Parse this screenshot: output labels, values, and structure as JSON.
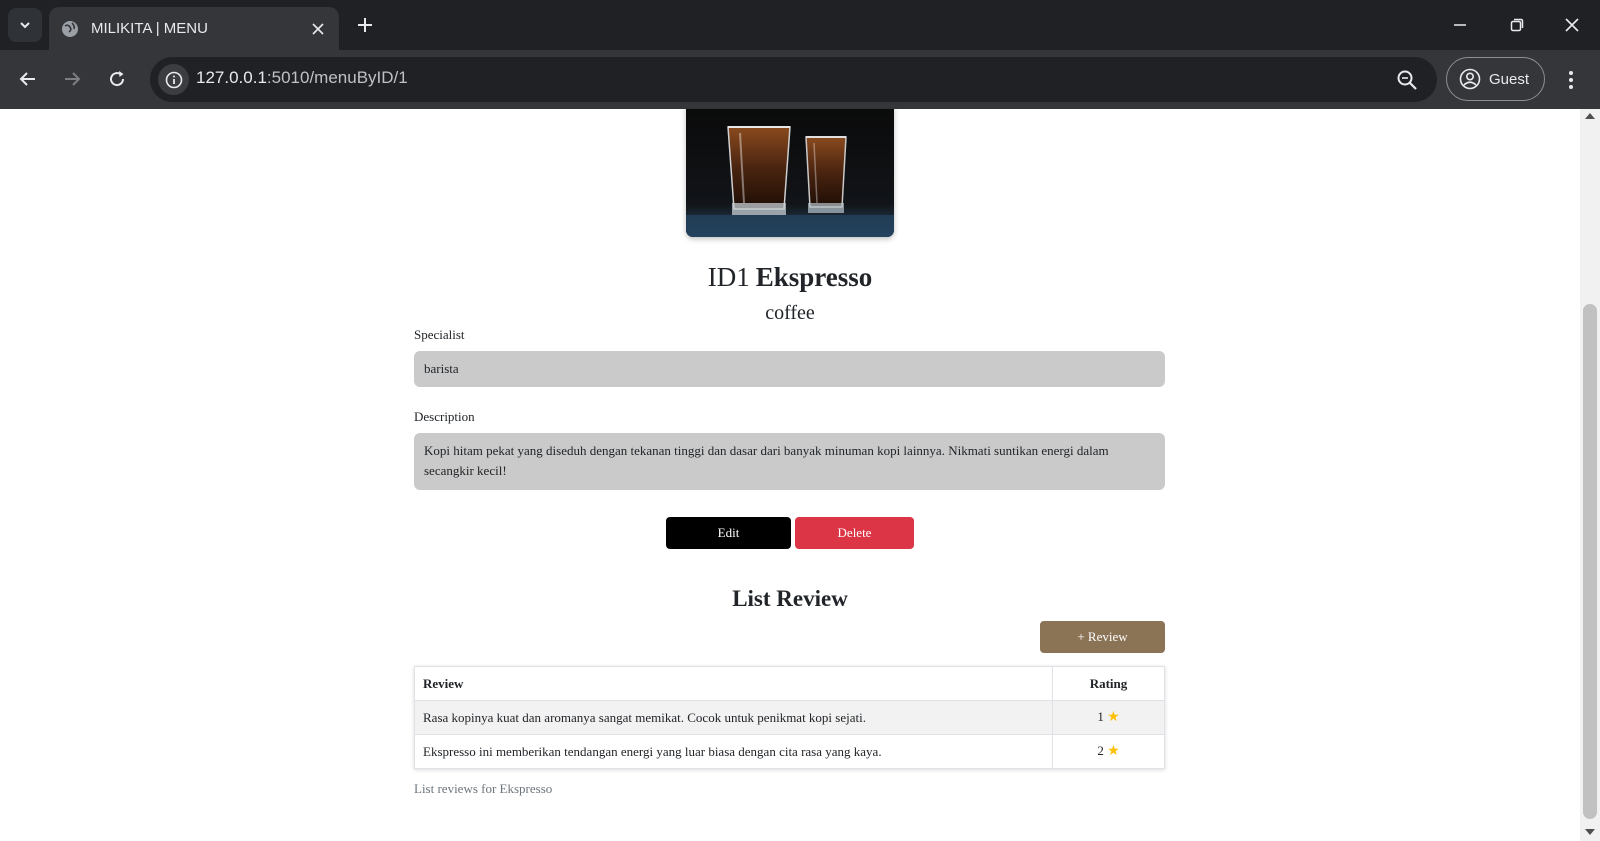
{
  "browser": {
    "tab_title": "MILIKITA | MENU",
    "url_host": "127.0.0.1",
    "url_path": ":5010/menuByID/1",
    "profile_label": "Guest"
  },
  "menu": {
    "id_label": "ID1",
    "name": "Ekspresso",
    "category": "coffee",
    "specialist_label": "Specialist",
    "specialist_value": "barista",
    "description_label": "Description",
    "description_value": "Kopi hitam pekat yang diseduh dengan tekanan tinggi dan dasar dari banyak minuman kopi lainnya. Nikmati suntikan energi dalam secangkir kecil!",
    "edit_label": "Edit",
    "delete_label": "Delete"
  },
  "reviews": {
    "heading": "List Review",
    "add_label": "+ Review",
    "columns": [
      "Review",
      "Rating"
    ],
    "rows": [
      {
        "text": "Rasa kopinya kuat dan aromanya sangat memikat. Cocok untuk penikmat kopi sejati.",
        "rating": "1"
      },
      {
        "text": "Ekspresso ini memberikan tendangan energi yang luar biasa dengan cita rasa yang kaya.",
        "rating": "2"
      }
    ],
    "caption": "List reviews for Ekspresso"
  },
  "icons": {
    "star": "star-icon",
    "accent_star": "#ffc107",
    "delete_color": "#dc3545",
    "review_btn_color": "#8b7355"
  }
}
